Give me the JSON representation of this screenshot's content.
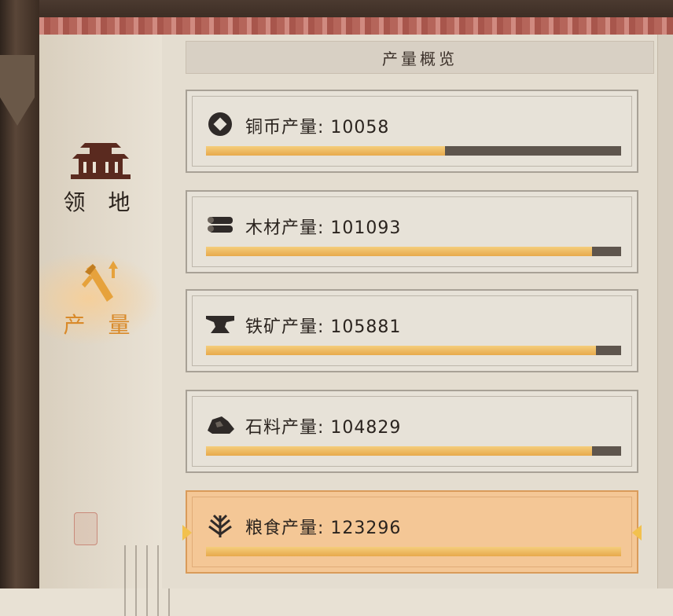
{
  "header": {
    "title": "产量概览"
  },
  "sidebar": {
    "items": [
      {
        "label": "领 地",
        "icon": "palace-icon",
        "active": false
      },
      {
        "label": "产 量",
        "icon": "production-icon",
        "active": true
      }
    ]
  },
  "production": {
    "items": [
      {
        "label": "铜币产量: 10058",
        "icon": "coin-icon",
        "progress": 0.575
      },
      {
        "label": "木材产量: 101093",
        "icon": "wood-icon",
        "progress": 0.93
      },
      {
        "label": "铁矿产量: 105881",
        "icon": "anvil-icon",
        "progress": 0.94
      },
      {
        "label": "石料产量: 104829",
        "icon": "stone-icon",
        "progress": 0.93
      },
      {
        "label": "粮食产量: 123296",
        "icon": "grain-icon",
        "progress": 1.0,
        "selected": true
      }
    ]
  },
  "colors": {
    "accent": "#f2c14e",
    "bar_track": "#5e554d",
    "selected_card": "#f4c796"
  }
}
